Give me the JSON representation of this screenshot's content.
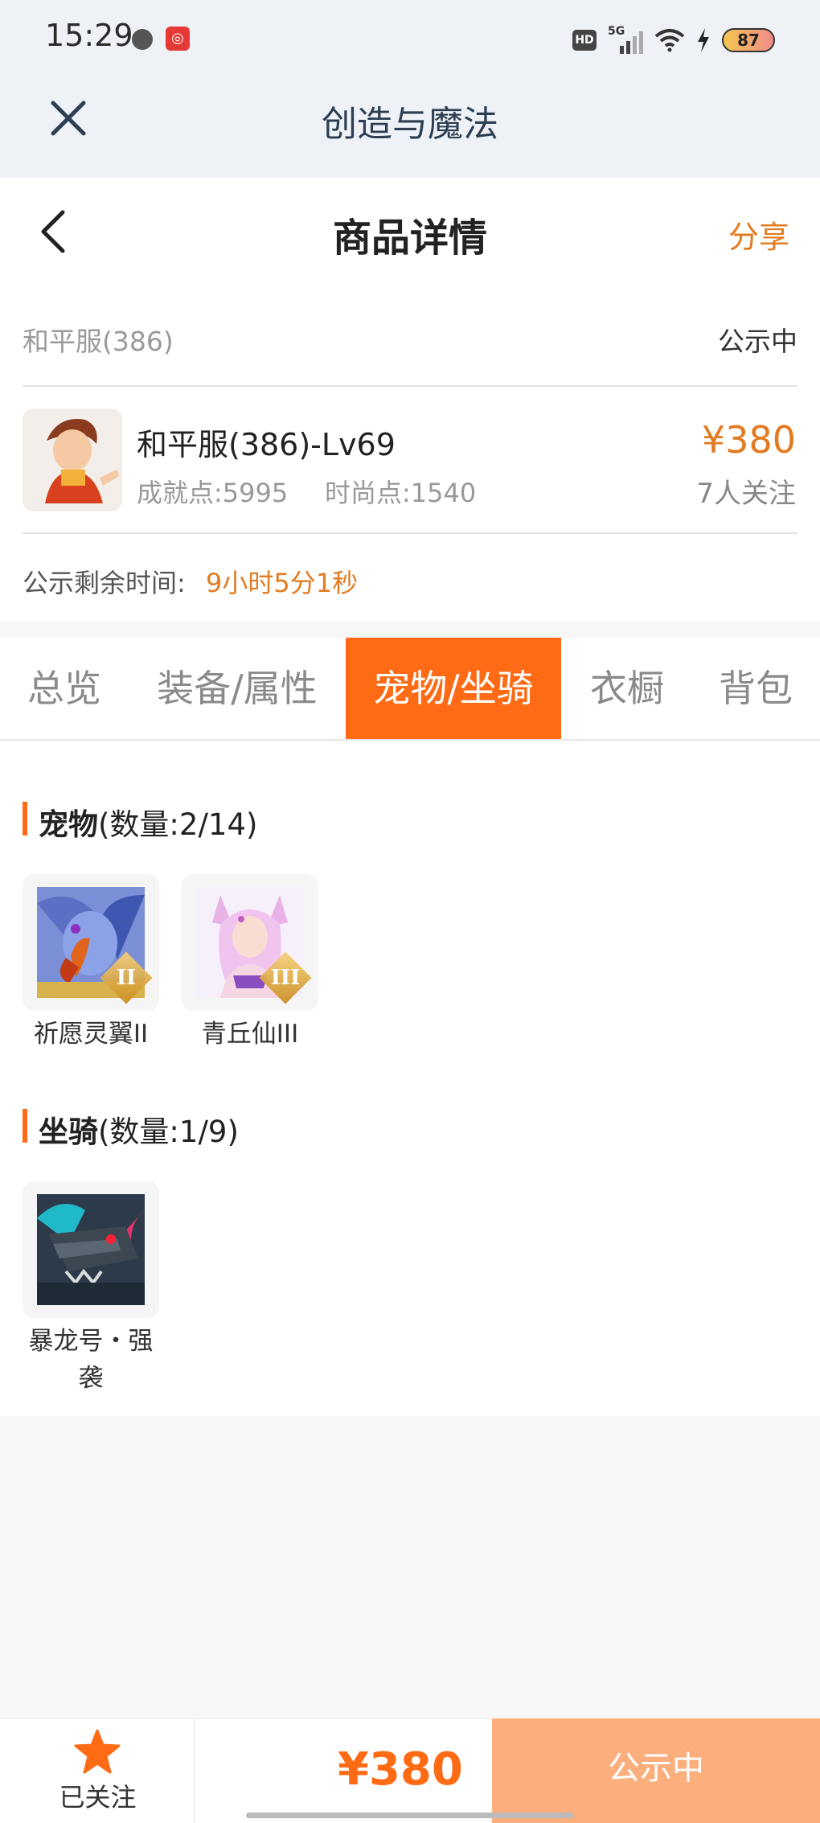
{
  "status_bar": {
    "time": "15:29",
    "icons": [
      "globe-icon",
      "netease-app-icon",
      "hd-icon",
      "signal-5g-icon",
      "wifi-icon",
      "charging-bolt-icon"
    ],
    "hd": "HD",
    "network": "5G",
    "battery": "87"
  },
  "header": {
    "title": "创造与魔法"
  },
  "nav": {
    "title": "商品详情",
    "share": "分享"
  },
  "product": {
    "server": "和平服(386)",
    "status": "公示中",
    "name": "和平服(386)-Lv69",
    "achievement": "成就点:5995",
    "fashion": "时尚点:1540",
    "price": "¥380",
    "watchers": "7人关注",
    "remaining_label": "公示剩余时间:",
    "remaining_value": "9小时5分1秒"
  },
  "tabs": [
    "总览",
    "装备/属性",
    "宠物/坐骑",
    "衣橱",
    "背包"
  ],
  "active_tab": "宠物/坐骑",
  "pets": {
    "heading": "宠物",
    "count": "(数量:2/14)",
    "items": [
      {
        "name": "祈愿灵翼II",
        "rank": "II"
      },
      {
        "name": "青丘仙III",
        "rank": "III"
      }
    ]
  },
  "mounts": {
    "heading": "坐骑",
    "count": "(数量:1/9)",
    "items": [
      {
        "name_line1": "暴龙号・强",
        "name_line2": "袭"
      }
    ]
  },
  "bottom": {
    "follow_label": "已关注",
    "price": "¥380",
    "action": "公示中"
  },
  "colors": {
    "accent": "#ff6a14",
    "price": "#e27b22",
    "action_bg": "#fcae7d"
  }
}
